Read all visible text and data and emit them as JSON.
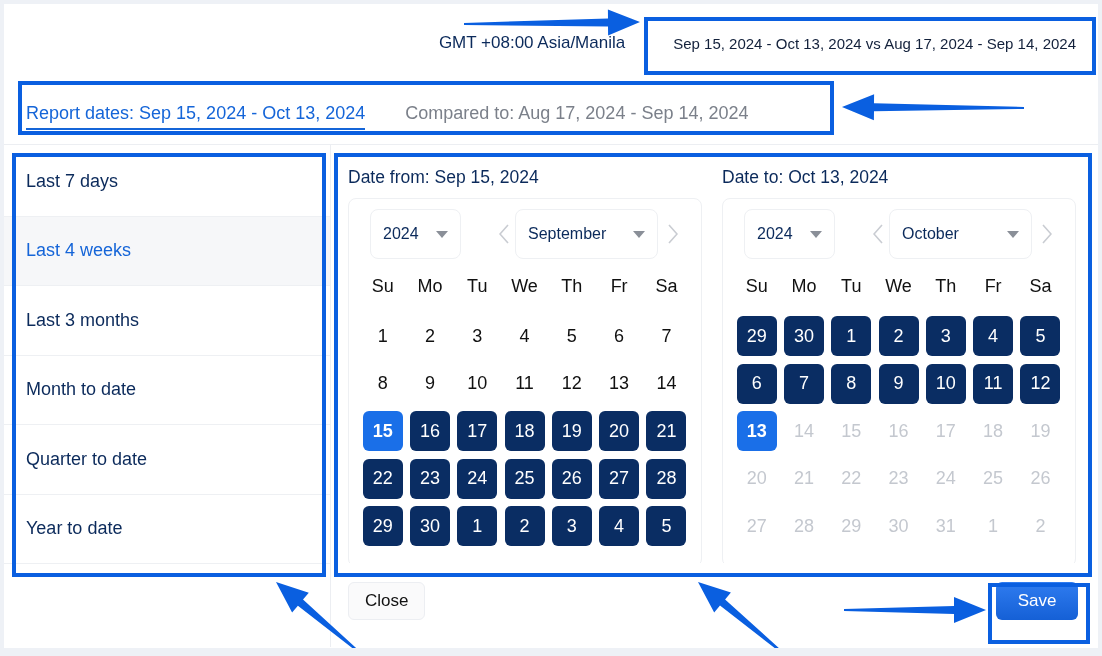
{
  "header": {
    "timezone": "GMT +08:00 Asia/Manila",
    "range_summary": "Sep 15, 2024 - Oct 13, 2024 vs Aug 17, 2024 - Sep 14, 2024"
  },
  "tabs": [
    {
      "label": "Report dates: Sep 15, 2024 - Oct 13, 2024",
      "selected": true
    },
    {
      "label": "Compared to: Aug 17, 2024 - Sep 14, 2024",
      "selected": false
    }
  ],
  "presets": [
    {
      "label": "Last 7 days",
      "selected": false
    },
    {
      "label": "Last 4 weeks",
      "selected": true
    },
    {
      "label": "Last 3 months",
      "selected": false
    },
    {
      "label": "Month to date",
      "selected": false
    },
    {
      "label": "Quarter to date",
      "selected": false
    },
    {
      "label": "Year to date",
      "selected": false
    }
  ],
  "calendars": [
    {
      "title": "Date from: Sep 15, 2024",
      "year": "2024",
      "month": "September",
      "weekdays": [
        "Su",
        "Mo",
        "Tu",
        "We",
        "Th",
        "Fr",
        "Sa"
      ],
      "weeks": [
        [
          {
            "day": "1",
            "kind": "plain"
          },
          {
            "day": "2",
            "kind": "plain"
          },
          {
            "day": "3",
            "kind": "plain"
          },
          {
            "day": "4",
            "kind": "plain"
          },
          {
            "day": "5",
            "kind": "plain"
          },
          {
            "day": "6",
            "kind": "plain"
          },
          {
            "day": "7",
            "kind": "plain"
          }
        ],
        [
          {
            "day": "8",
            "kind": "plain"
          },
          {
            "day": "9",
            "kind": "plain"
          },
          {
            "day": "10",
            "kind": "plain"
          },
          {
            "day": "11",
            "kind": "plain"
          },
          {
            "day": "12",
            "kind": "plain"
          },
          {
            "day": "13",
            "kind": "plain"
          },
          {
            "day": "14",
            "kind": "plain"
          }
        ],
        [
          {
            "day": "15",
            "kind": "endpoint"
          },
          {
            "day": "16",
            "kind": "range"
          },
          {
            "day": "17",
            "kind": "range"
          },
          {
            "day": "18",
            "kind": "range"
          },
          {
            "day": "19",
            "kind": "range"
          },
          {
            "day": "20",
            "kind": "range"
          },
          {
            "day": "21",
            "kind": "range"
          }
        ],
        [
          {
            "day": "22",
            "kind": "range"
          },
          {
            "day": "23",
            "kind": "range"
          },
          {
            "day": "24",
            "kind": "range"
          },
          {
            "day": "25",
            "kind": "range"
          },
          {
            "day": "26",
            "kind": "range"
          },
          {
            "day": "27",
            "kind": "range"
          },
          {
            "day": "28",
            "kind": "range"
          }
        ],
        [
          {
            "day": "29",
            "kind": "range"
          },
          {
            "day": "30",
            "kind": "range"
          },
          {
            "day": "1",
            "kind": "range"
          },
          {
            "day": "2",
            "kind": "range"
          },
          {
            "day": "3",
            "kind": "range"
          },
          {
            "day": "4",
            "kind": "range"
          },
          {
            "day": "5",
            "kind": "range"
          }
        ]
      ]
    },
    {
      "title": "Date to: Oct 13, 2024",
      "year": "2024",
      "month": "October",
      "weekdays": [
        "Su",
        "Mo",
        "Tu",
        "We",
        "Th",
        "Fr",
        "Sa"
      ],
      "weeks": [
        [
          {
            "day": "29",
            "kind": "range"
          },
          {
            "day": "30",
            "kind": "range"
          },
          {
            "day": "1",
            "kind": "range"
          },
          {
            "day": "2",
            "kind": "range"
          },
          {
            "day": "3",
            "kind": "range"
          },
          {
            "day": "4",
            "kind": "range"
          },
          {
            "day": "5",
            "kind": "range"
          }
        ],
        [
          {
            "day": "6",
            "kind": "range"
          },
          {
            "day": "7",
            "kind": "range"
          },
          {
            "day": "8",
            "kind": "range"
          },
          {
            "day": "9",
            "kind": "range"
          },
          {
            "day": "10",
            "kind": "range"
          },
          {
            "day": "11",
            "kind": "range"
          },
          {
            "day": "12",
            "kind": "range"
          }
        ],
        [
          {
            "day": "13",
            "kind": "endpoint"
          },
          {
            "day": "14",
            "kind": "muted"
          },
          {
            "day": "15",
            "kind": "muted"
          },
          {
            "day": "16",
            "kind": "muted"
          },
          {
            "day": "17",
            "kind": "muted"
          },
          {
            "day": "18",
            "kind": "muted"
          },
          {
            "day": "19",
            "kind": "muted"
          }
        ],
        [
          {
            "day": "20",
            "kind": "muted"
          },
          {
            "day": "21",
            "kind": "muted"
          },
          {
            "day": "22",
            "kind": "muted"
          },
          {
            "day": "23",
            "kind": "muted"
          },
          {
            "day": "24",
            "kind": "muted"
          },
          {
            "day": "25",
            "kind": "muted"
          },
          {
            "day": "26",
            "kind": "muted"
          }
        ],
        [
          {
            "day": "27",
            "kind": "muted"
          },
          {
            "day": "28",
            "kind": "muted"
          },
          {
            "day": "29",
            "kind": "muted"
          },
          {
            "day": "30",
            "kind": "muted"
          },
          {
            "day": "31",
            "kind": "muted"
          },
          {
            "day": "1",
            "kind": "muted"
          },
          {
            "day": "2",
            "kind": "muted"
          }
        ]
      ]
    }
  ],
  "buttons": [
    {
      "label": "Close",
      "kind": "secondary"
    },
    {
      "label": "Save",
      "kind": "primary"
    }
  ]
}
